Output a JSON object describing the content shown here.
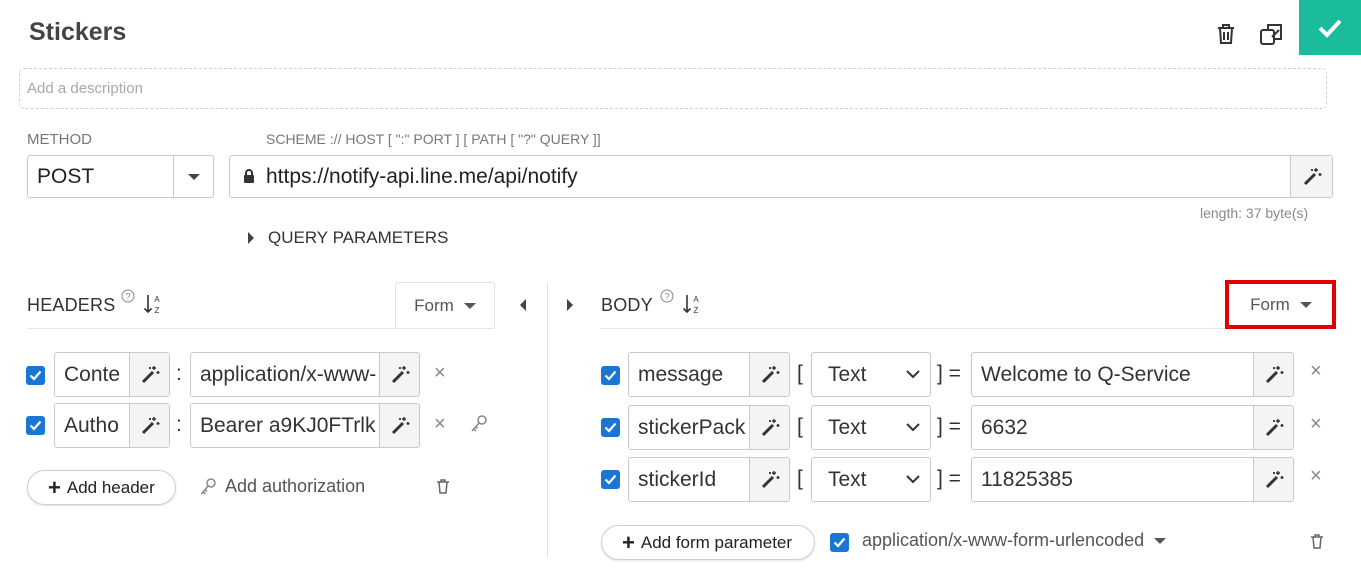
{
  "request": {
    "title": "Stickers",
    "description_placeholder": "Add a description"
  },
  "method": {
    "label": "METHOD",
    "value": "POST"
  },
  "url": {
    "label": "SCHEME :// HOST [ \":\" PORT ] [ PATH [ \"?\" QUERY ]]",
    "value": "https://notify-api.line.me/api/notify",
    "length_text": "length: 37 byte(s)"
  },
  "query_parameters_label": "QUERY PARAMETERS",
  "headers": {
    "title": "HEADERS",
    "mode": "Form",
    "rows": [
      {
        "name": "Conte",
        "value": "application/x-www-"
      },
      {
        "name": "Autho",
        "value": "Bearer a9KJ0FTrlk"
      }
    ],
    "add_header": "Add header",
    "add_authorization": "Add authorization"
  },
  "body": {
    "title": "BODY",
    "mode": "Form",
    "rows": [
      {
        "name": "message",
        "type": "Text",
        "value": "Welcome to Q-Service"
      },
      {
        "name": "stickerPack",
        "type": "Text",
        "value": "6632"
      },
      {
        "name": "stickerId",
        "type": "Text",
        "value": "11825385"
      }
    ],
    "add_form_parameter": "Add form parameter",
    "content_type": "application/x-www-form-urlencoded"
  },
  "colors": {
    "accent": "#1abc9c",
    "checkbox": "#1976d2",
    "highlight": "#e00000"
  }
}
